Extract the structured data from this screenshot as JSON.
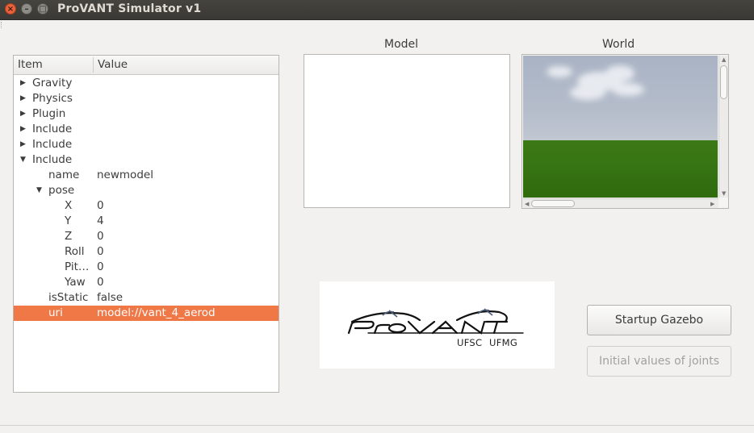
{
  "window": {
    "title": "ProVANT Simulator v1",
    "close_glyph": "×",
    "minimize_glyph": "–",
    "maximize_glyph": "□"
  },
  "tree": {
    "columns": {
      "item": "Item",
      "value": "Value"
    },
    "rows": [
      {
        "key": "Gravity",
        "value": "",
        "arrow": "▶"
      },
      {
        "key": "Physics",
        "value": "",
        "arrow": "▶"
      },
      {
        "key": "Plugin",
        "value": "",
        "arrow": "▶"
      },
      {
        "key": "Include",
        "value": "",
        "arrow": "▶"
      },
      {
        "key": "Include",
        "value": "",
        "arrow": "▶"
      },
      {
        "key": "Include",
        "value": "",
        "arrow": "▼"
      },
      {
        "key": "name",
        "value": "newmodel"
      },
      {
        "key": "pose",
        "value": "",
        "arrow": "▼"
      },
      {
        "key": "X",
        "value": "0"
      },
      {
        "key": "Y",
        "value": "4"
      },
      {
        "key": "Z",
        "value": "0"
      },
      {
        "key": "Roll",
        "value": "0"
      },
      {
        "key": "Pit…",
        "value": "0"
      },
      {
        "key": "Yaw",
        "value": "0"
      },
      {
        "key": "isStatic",
        "value": "false"
      },
      {
        "key": "uri",
        "value": "model://vant_4_aerod"
      }
    ]
  },
  "panels": {
    "model_label": "Model",
    "world_label": "World"
  },
  "logo": {
    "wordmark": "ProVANT",
    "sub_left": "UFSC",
    "sub_right": "UFMG"
  },
  "buttons": {
    "startup": "Startup Gazebo",
    "initial_values": "Initial values of joints"
  },
  "colors": {
    "selection": "#f07746",
    "titlebar": "#3c3b37",
    "ground": "#3c7a16"
  }
}
